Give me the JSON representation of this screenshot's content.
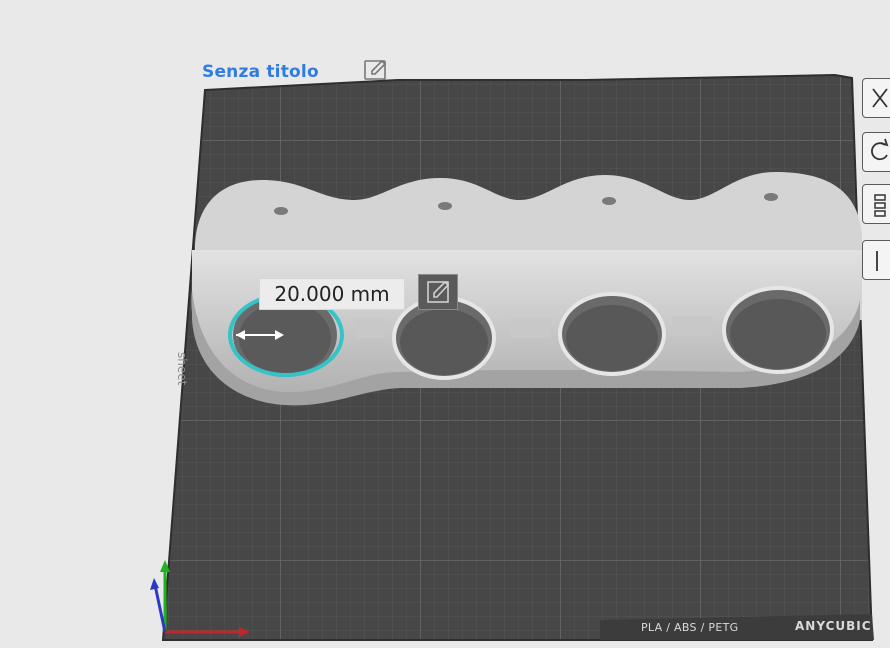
{
  "project": {
    "title": "Senza titolo"
  },
  "measurement": {
    "value": "20.000 mm"
  },
  "bed": {
    "material_label": "PLA / ABS / PETG",
    "brand_label": "ANYCUBIC",
    "sheet_label": "sheet"
  },
  "icons": {
    "title_edit": "pencil-icon",
    "measure_edit": "pencil-icon",
    "sidebar": [
      "close-icon",
      "rotate-icon",
      "layers-icon",
      "settings-icon"
    ]
  },
  "colors": {
    "title": "#2f7de1",
    "bed": "#4a4a4a",
    "model": "#c9c9c9",
    "selection_ring": "#34c3c6",
    "axis_x": "#c0262d",
    "axis_y": "#1eb21e",
    "axis_z": "#2b39c7"
  }
}
